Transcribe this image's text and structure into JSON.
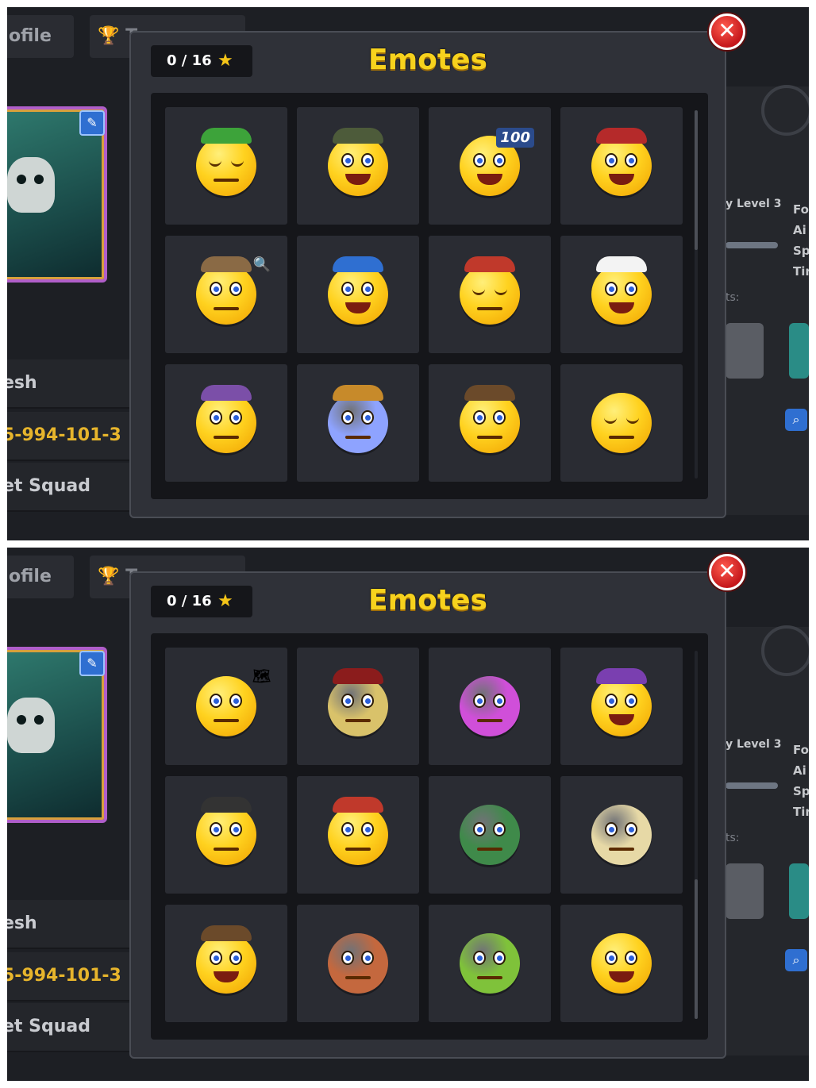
{
  "background": {
    "tab_profile_label": "ofile",
    "tab_trophy_label": "T",
    "rows": [
      "esh",
      "5-994-101-3",
      "et Squad"
    ],
    "level_label": "y Level 3",
    "stats_letters": [
      "Fo",
      "Ai",
      "Sp",
      "Tir"
    ],
    "stats_suffix": "ts:"
  },
  "screens": [
    {
      "counter": "0 / 16",
      "title": "Emotes",
      "close_label": "✕",
      "scroll_position": 0.0,
      "emotes": [
        {
          "icon": "laurel-sleepy-emote"
        },
        {
          "icon": "cowboy-horseshoe-emote"
        },
        {
          "icon": "wink-100-emote"
        },
        {
          "icon": "bagpipe-emote"
        },
        {
          "icon": "detective-emote"
        },
        {
          "icon": "football-helmet-emote"
        },
        {
          "icon": "mandarin-tea-emote"
        },
        {
          "icon": "genie-emote"
        },
        {
          "icon": "earmuffs-grumpy-emote"
        },
        {
          "icon": "frozen-viking-emote"
        },
        {
          "icon": "explorer-hat-emote"
        },
        {
          "icon": "snap-8ball-emote"
        }
      ]
    },
    {
      "counter": "0 / 16",
      "title": "Emotes",
      "close_label": "✕",
      "scroll_position": 1.0,
      "emotes": [
        {
          "icon": "map-reader-emote"
        },
        {
          "icon": "hooded-lantern-emote"
        },
        {
          "icon": "colorful-glasses-emote"
        },
        {
          "icon": "jester-masquerade-emote"
        },
        {
          "icon": "gangster-fedora-emote"
        },
        {
          "icon": "headphones-drummer-emote"
        },
        {
          "icon": "zombie-8ball-emote"
        },
        {
          "icon": "mummy-emote"
        },
        {
          "icon": "steampunk-gramophone-emote"
        },
        {
          "icon": "planet-rings-emote"
        },
        {
          "icon": "green-dizzy-cat-emote"
        },
        {
          "icon": "wink-smile-emote"
        }
      ]
    }
  ],
  "colors": {
    "title_yellow": "#f7d21d",
    "close_red": "#d62323",
    "code_gold": "#e7b52c",
    "accent_blue": "#2f6fd1"
  }
}
